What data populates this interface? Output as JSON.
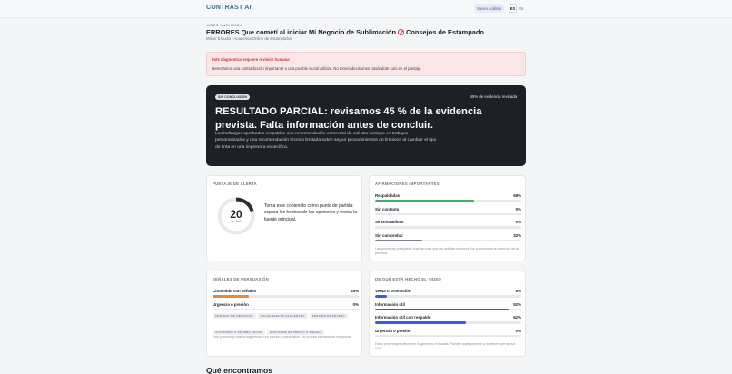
{
  "brand": "CONTRAST AI",
  "header": {
    "new_analysis": "Nuevo análisis",
    "lang_es": "ES",
    "lang_en": "EN"
  },
  "video": {
    "label": "VIDEO ANALIZADO",
    "title_part1": "ERRORES Que cometí al iniciar Mi Negocio de Sublimación",
    "title_part2": "Consejos de Estampado",
    "channel": "Mister Estudio | Academia Online de Estampados"
  },
  "alert": {
    "title": "Este diagnóstico requiere revisión humana",
    "body": "Detectamos una contradicción importante o una posible acción oficial. No tomes decisiones basándote solo en el puntaje."
  },
  "hero": {
    "badge": "SIN CONCLUSIÓN",
    "evidence": "45% de evidencia revisada",
    "title": "RESULTADO PARCIAL: revisamos 45 % de la evidencia prevista. Falta información antes de concluir.",
    "body": "Los hallazgos aprobados respaldan una recomendación comercial de solicitar anticipo en trabajos personalizados y una recomendación técnica limitada sobre seguir procedimientos de limpieza al cambiar el tipo de tinta en una impresora específica."
  },
  "score": {
    "title": "PUNTAJE DE ALERTA",
    "value": "20",
    "max_label": "de 100",
    "value_num": 20,
    "max_num": 100,
    "text": "Toma este contenido como punto de partida: separa los hechos de las opiniones y revisa la fuente principal."
  },
  "claims": {
    "title": "AFIRMACIONES IMPORTANTES",
    "rows": [
      {
        "label": "Respaldadas",
        "value": "68%",
        "pct": 68,
        "color": "#3fae69"
      },
      {
        "label": "Sin contexto",
        "value": "0%",
        "pct": 0,
        "color": "#8a8f99"
      },
      {
        "label": "Se contradicen",
        "value": "0%",
        "pct": 0,
        "color": "#d9534f"
      },
      {
        "label": "Sin comprobar",
        "value": "32%",
        "pct": 32,
        "color": "#7c8190"
      }
    ],
    "note": "Las promesas principales cuentan más que los detalles menores. No sumaremos la intención de la persona."
  },
  "persuasion": {
    "title": "SEÑALES DE PERSUASIÓN",
    "rows": [
      {
        "label": "Contenido con señales",
        "value": "25%",
        "pct": 25,
        "color": "#e8892b"
      },
      {
        "label": "Urgencia o presión",
        "value": "0%",
        "pct": 0,
        "color": "#e8892b"
      }
    ],
    "chips": [
      "CERTEZA SIN RESPALDO",
      "CAUSA-EFECTO EXAGERADO",
      "PRESIÓN DE PRUEBA",
      "AUTORIDAD O PRUEBA SOCIAL",
      "ENCUADRE DE PRECIO O RIESGO"
    ],
    "note": "Este porcentaje marca fragmentos con presión o persuasión. No prueba intención de manipular."
  },
  "made_of": {
    "title": "DE QUÉ ESTÁ HECHO EL VIDEO",
    "rows": [
      {
        "label": "Venta o promoción",
        "value": "8%",
        "pct": 8,
        "color": "#3d5bd9"
      },
      {
        "label": "Información útil",
        "value": "92%",
        "pct": 92,
        "color": "#3d5bd9"
      },
      {
        "label": "Información útil con respaldo",
        "value": "62%",
        "pct": 62,
        "color": "#3d5bd9"
      },
      {
        "label": "Urgencia o presión",
        "value": "0%",
        "pct": 0,
        "color": "#3d5bd9"
      }
    ],
    "note": "Estos porcentajes describen fragmentos revisados. Pueden superponerse y no tienen que sumar 100."
  },
  "found": {
    "title": "Qué encontramos"
  },
  "colors": {
    "brand": "#2e6f94",
    "hero_bg": "#1d2026",
    "alert_bg": "#fae6e6",
    "alert_title": "#c43b3b",
    "gauge": "#2a2d33"
  }
}
